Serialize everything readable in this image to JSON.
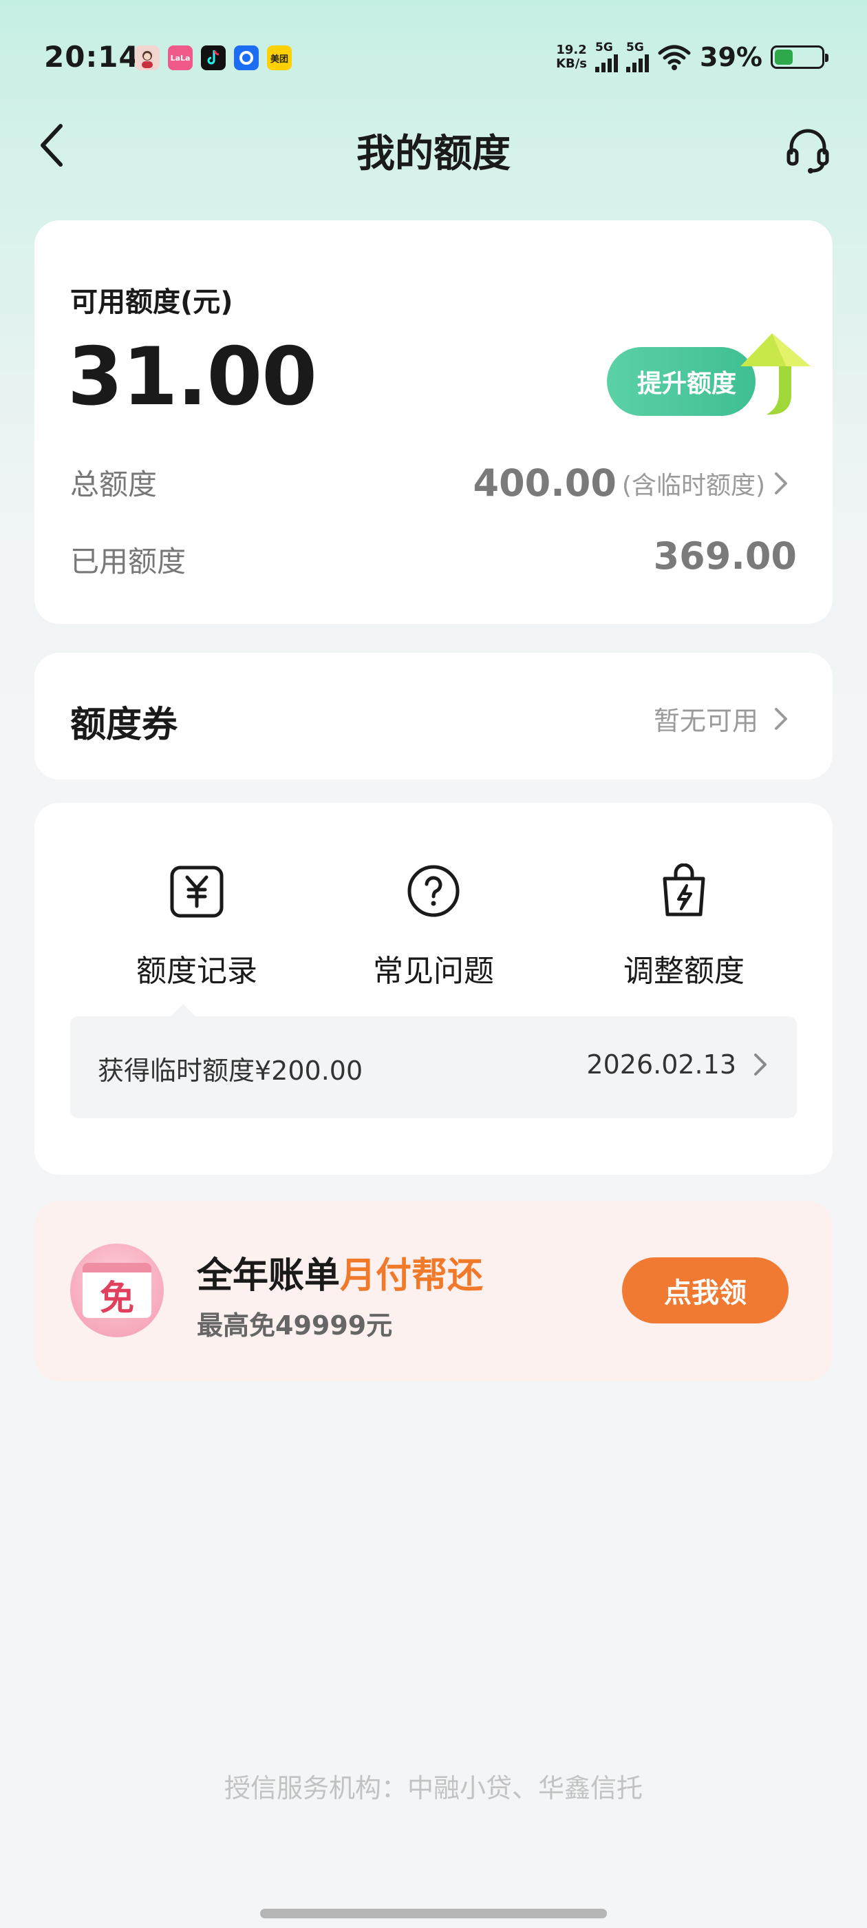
{
  "status_bar": {
    "time": "20:14",
    "net_speed_value": "19.2",
    "net_speed_unit": "KB/s",
    "signal1_label": "5G",
    "signal2_label": "5G",
    "battery_percent": "39%",
    "battery_level": 0.39,
    "apps": [
      {
        "name": "avatar-app-icon",
        "text": ""
      },
      {
        "name": "lala-app-icon",
        "text": "LaLa"
      },
      {
        "name": "tiktok-app-icon",
        "text": ""
      },
      {
        "name": "blue-app-icon",
        "text": ""
      },
      {
        "name": "meituan-app-icon",
        "text": "美团"
      }
    ]
  },
  "nav": {
    "title": "我的额度"
  },
  "limit": {
    "available_label": "可用额度(元)",
    "available_value": "31.00",
    "raise_button": "提升额度",
    "total_label": "总额度",
    "total_value": "400.00",
    "total_note": "(含临时额度)",
    "used_label": "已用额度",
    "used_value": "369.00"
  },
  "coupon": {
    "title": "额度券",
    "status": "暂无可用"
  },
  "actions": {
    "items": [
      {
        "label": "额度记录",
        "icon": "yuan-doc-icon"
      },
      {
        "label": "常见问题",
        "icon": "question-circle-icon"
      },
      {
        "label": "调整额度",
        "icon": "lightning-bag-icon"
      }
    ],
    "record_text": "获得临时额度¥200.00",
    "record_date": "2026.02.13"
  },
  "promo": {
    "icon_text": "免",
    "title_main": "全年账单",
    "title_highlight": "月付帮还",
    "subtitle": "最高免49999元",
    "button": "点我领"
  },
  "footer": {
    "text": "授信服务机构：中融小贷、华鑫信托"
  },
  "colors": {
    "accent_green": "#3fbf92",
    "promo_orange": "#f07a32",
    "battery_green": "#2ea84a"
  }
}
